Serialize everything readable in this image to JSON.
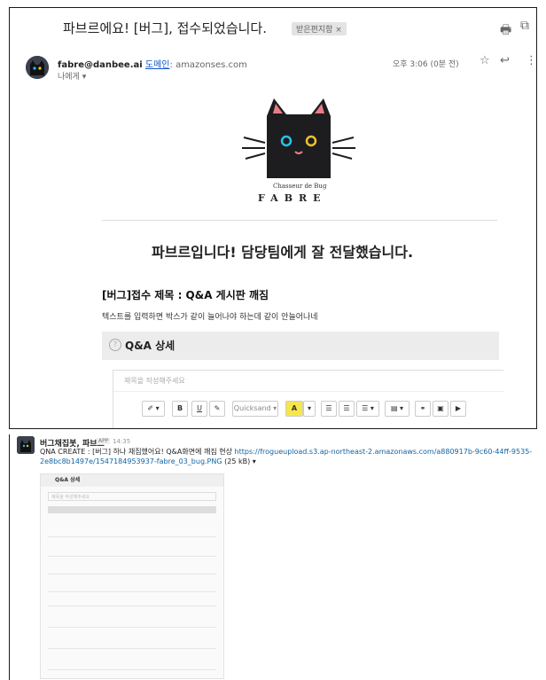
{
  "email": {
    "subject": "파브르에요! [버그], 접수되었습니다.",
    "label": "받은편지함 ×",
    "sender_email": "fabre@danbee.ai",
    "via_label": "도메인",
    "via_domain": "amazonses.com",
    "to_me": "나에게 ▾",
    "time": "오후 3:06 (0분 전)",
    "icons": [
      "print-icon",
      "open-new-window-icon",
      "star-icon",
      "reply-icon",
      "more-vert-icon"
    ]
  },
  "logo": {
    "line1": "Chasseur de Bug",
    "line2": "FABRE"
  },
  "body": {
    "headline": "파브르입니다! 담당팀에게 잘 전달했습니다.",
    "bug_title": "[버그]접수 제목 : Q&A 게시판 깨짐",
    "bug_desc": "텍스트를 입력하면 박스가 같이 늘어나야 하는데 같이 안늘어나네",
    "qa_title": "Q&A 상세",
    "qa_placeholder": "제목을 작성해주세요",
    "toolbar": [
      "✐ ▾",
      "B",
      "U",
      "✎",
      "Quicksand ▾",
      "A",
      "▾",
      "☰",
      "☰",
      "☰ ▾",
      "▤ ▾",
      "⚭",
      "▣",
      "▶"
    ]
  },
  "slack": {
    "name": "버그채집봇, 파브르",
    "app": "APP",
    "time": "14:35",
    "msg_prefix": "QNA CREATE : [버그] 하나 채집했어요! Q&A화면에 깨짐 현상 ",
    "link": "https://frogueupload.s3.ap-northeast-2.amazonaws.com/a880917b-9c60-44ff-9535-2e8bc8b1497e/1547184953937-fabre_03_bug.PNG",
    "size": " (25 kB) ▾",
    "thumb_title": "Q&A 상세",
    "thumb_placeholder": "제목을 작성해주세요"
  },
  "colors": {
    "link": "#1264a3",
    "cat_body": "#1d1d1f",
    "cat_eye_left": "#23c4ea",
    "cat_eye_right": "#f1c12f",
    "cat_ear_inner": "#e77d86",
    "highlight": "#f6e64b"
  }
}
